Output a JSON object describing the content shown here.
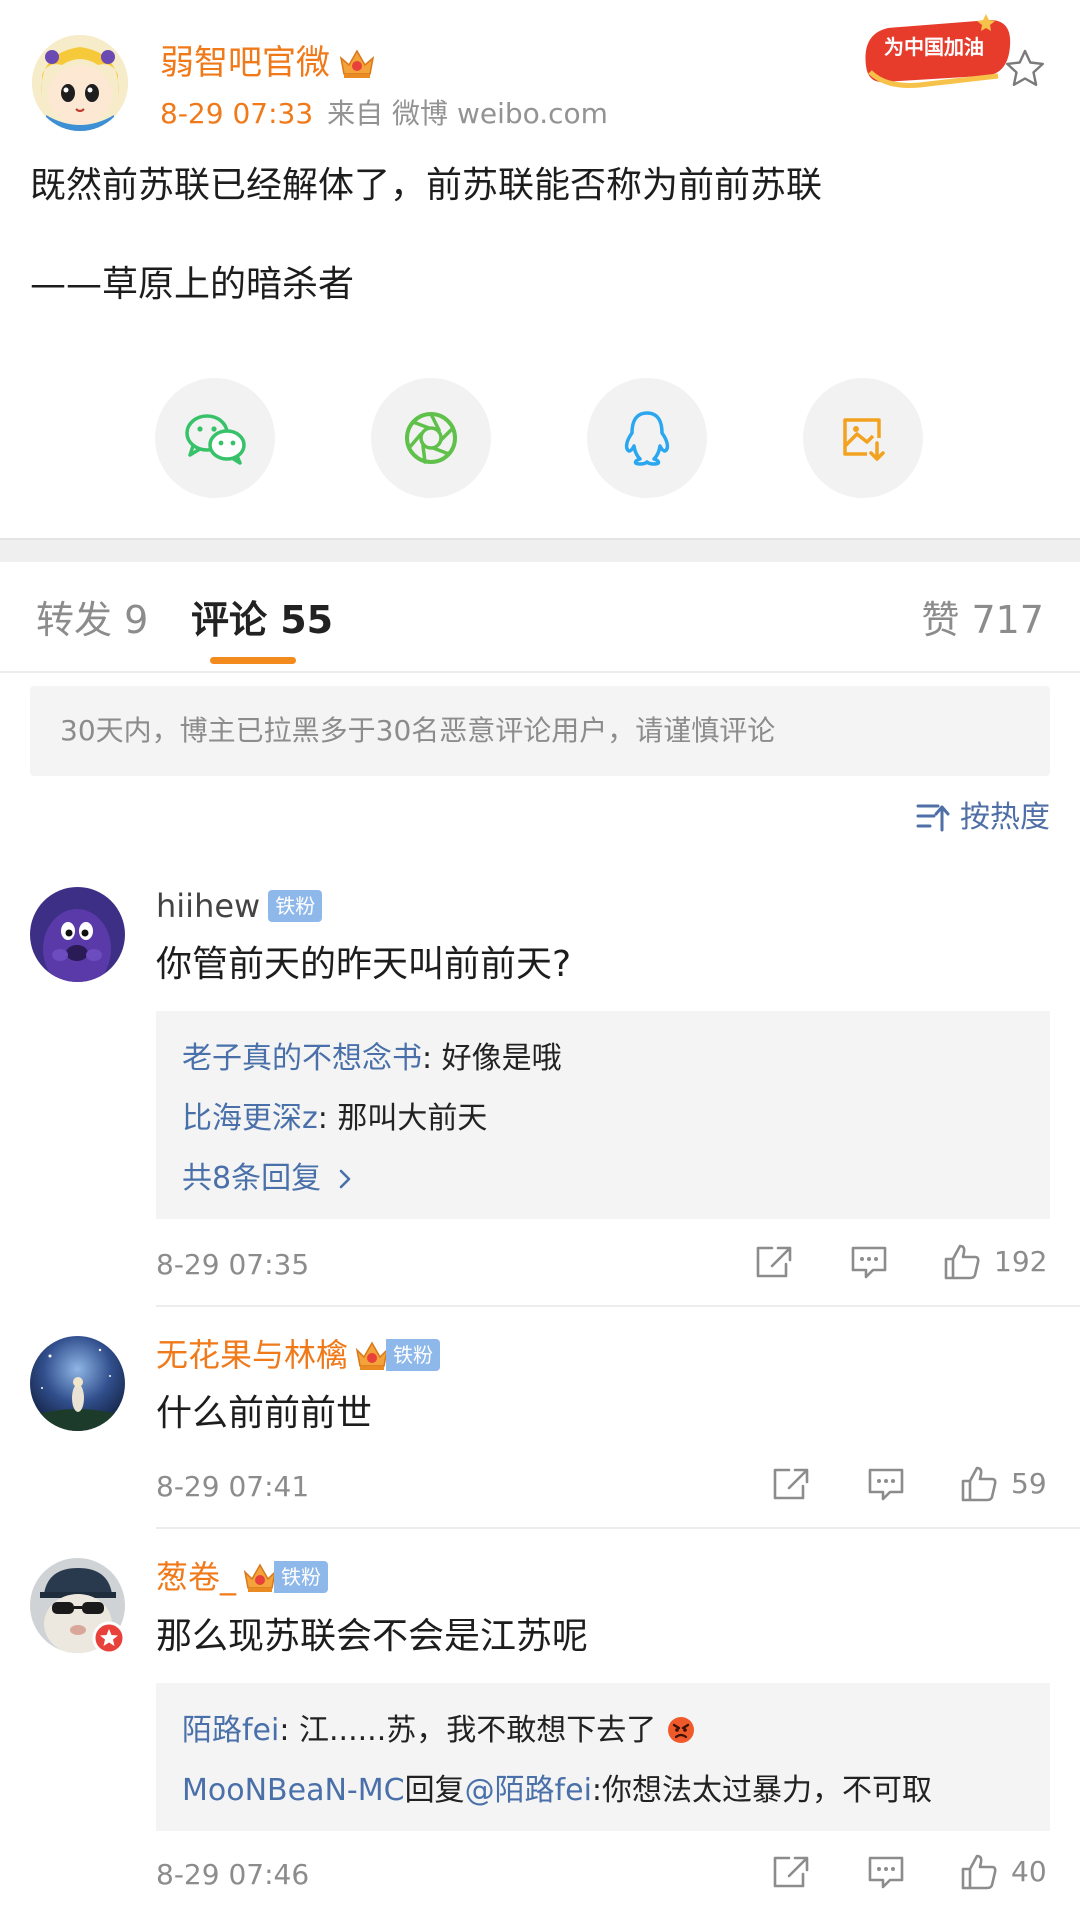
{
  "post": {
    "author": "弱智吧官微",
    "time": "8-29 07:33",
    "source": "来自 微博 weibo.com",
    "badge_text": "为中国加油",
    "text_line1": "既然前苏联已经解体了，前苏联能否称为前前苏联",
    "text_line2": "——草原上的暗杀者"
  },
  "tabs": {
    "repost": "转发 9",
    "comment": "评论 55",
    "like": "赞 717"
  },
  "notice": "30天内，博主已拉黑多于30名恶意评论用户，请谨慎评论",
  "sort_label": "按热度",
  "colors": {
    "accent": "#f07a1a",
    "link": "#4a70aa",
    "fan_badge": "#8fb8ea"
  },
  "comments": [
    {
      "name": "hiihew",
      "fan": "铁粉",
      "text": "你管前天的昨天叫前前天?",
      "replies": [
        {
          "user": "老子真的不想念书",
          "sep": ": ",
          "text": "好像是哦"
        },
        {
          "user": "比海更深z",
          "sep": ": ",
          "text": "那叫大前天"
        }
      ],
      "more": "共8条回复",
      "time": "8-29 07:35",
      "likes": "192"
    },
    {
      "name": "无花果与林檎",
      "fan": "铁粉",
      "text": "什么前前前世",
      "time": "8-29 07:41",
      "likes": "59"
    },
    {
      "name": "葱卷_",
      "fan": "铁粉",
      "text": "那么现苏联会不会是江苏呢",
      "replies": [
        {
          "user": "陌路fei",
          "sep": ": ",
          "text": "江......苏，我不敢想下去了"
        },
        {
          "user": "MooNBeaN-MC",
          "mid": "回复",
          "user2": "@陌路fei",
          "text": ":你想法太过暴力，不可取"
        }
      ],
      "time": "8-29 07:46",
      "likes": "40"
    }
  ]
}
